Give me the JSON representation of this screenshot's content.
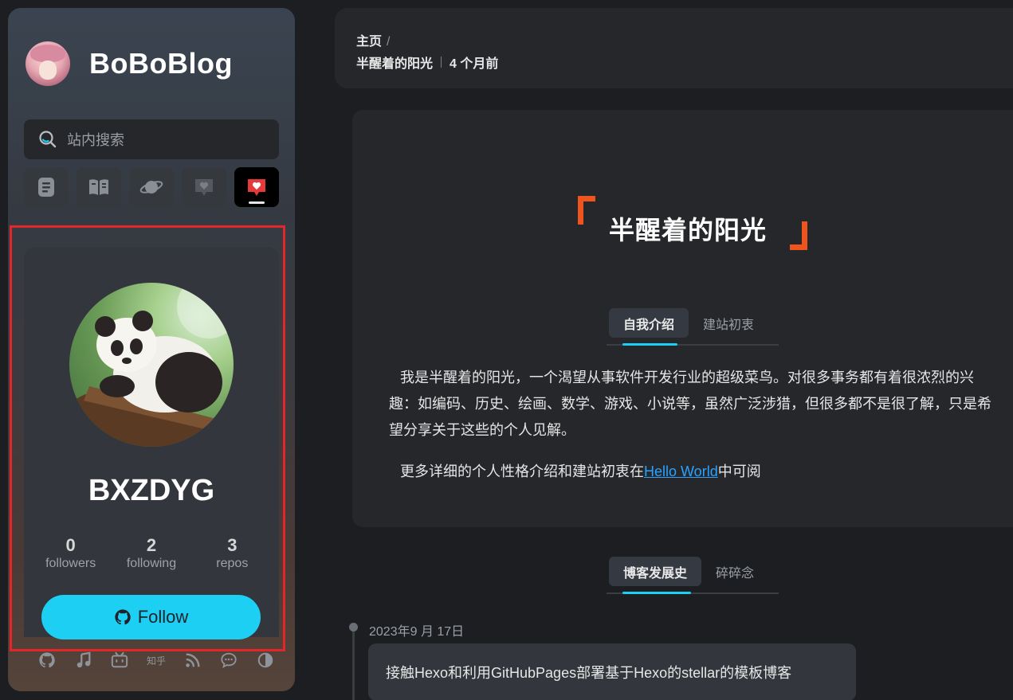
{
  "sidebar": {
    "brand_title": "BoBoBlog",
    "search_placeholder": "站内搜索",
    "nav_icons": [
      "posts-icon",
      "wiki-icon",
      "planet-icon",
      "comments-icon",
      "heart-message-icon"
    ],
    "profile": {
      "name": "BXZDYG",
      "stats": [
        {
          "value": "0",
          "label": "followers"
        },
        {
          "value": "2",
          "label": "following"
        },
        {
          "value": "3",
          "label": "repos"
        }
      ],
      "follow_label": "Follow"
    },
    "social": {
      "zhihu_label": "知乎"
    }
  },
  "breadcrumb": {
    "home": "主页",
    "separator": "/",
    "page": "半醒着的阳光",
    "time": "4 个月前"
  },
  "about": {
    "title": "半醒着的阳光",
    "tabs": [
      "自我介绍",
      "建站初衷"
    ],
    "intro": "我是半醒着的阳光，一个渴望从事软件开发行业的超级菜鸟。对很多事务都有着很浓烈的兴趣：如编码、历史、绘画、数学、游戏、小说等，虽然广泛涉猎，但很多都不是很了解，只是希望分享关于这些的个人见解。",
    "more_prefix": "更多详细的个人性格介绍和建站初衷在",
    "more_link": "Hello World",
    "more_suffix": "中可阅"
  },
  "history": {
    "tabs": [
      "博客发展史",
      "碎碎念"
    ],
    "date": "2023年9 月 17日",
    "entry": "接触Hexo和利用GitHubPages部署基于Hexo的stellar的模板博客"
  },
  "colors": {
    "accent": "#1ecff4",
    "bracket": "#f0541e",
    "link": "#2aa3ff",
    "highlight_border": "#e3262a"
  }
}
